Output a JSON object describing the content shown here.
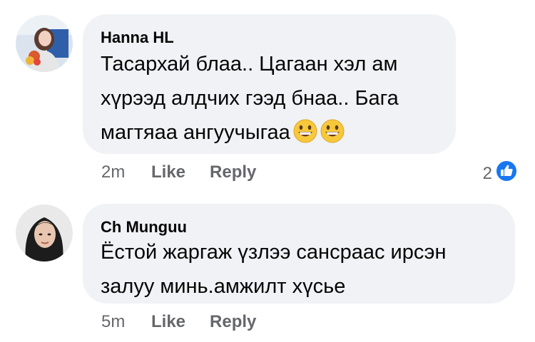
{
  "comments": [
    {
      "author": "Hanna HL",
      "text": "Тасархай блаа.. Цагаан хэл ам\nхүрээд алдчих гээд бнаа.. Бага\nмагтяаа ангуучыгаа",
      "emoji": [
        "grinning-face-icon",
        "grinning-face-icon"
      ],
      "time": "2m",
      "like_label": "Like",
      "reply_label": "Reply",
      "reaction_count": "2",
      "reaction_icon": "like-icon"
    },
    {
      "author": "Ch Munguu",
      "text": "Ёстой жаргаж үзлээ сансраас ирсэн\nзалуу минь.амжилт хүсье",
      "time": "5m",
      "like_label": "Like",
      "reply_label": "Reply"
    }
  ],
  "colors": {
    "bubble": "#f0f2f5",
    "meta": "#65676b",
    "like_blue": "#1877f2",
    "emoji_yellow": "#f7c83b"
  }
}
